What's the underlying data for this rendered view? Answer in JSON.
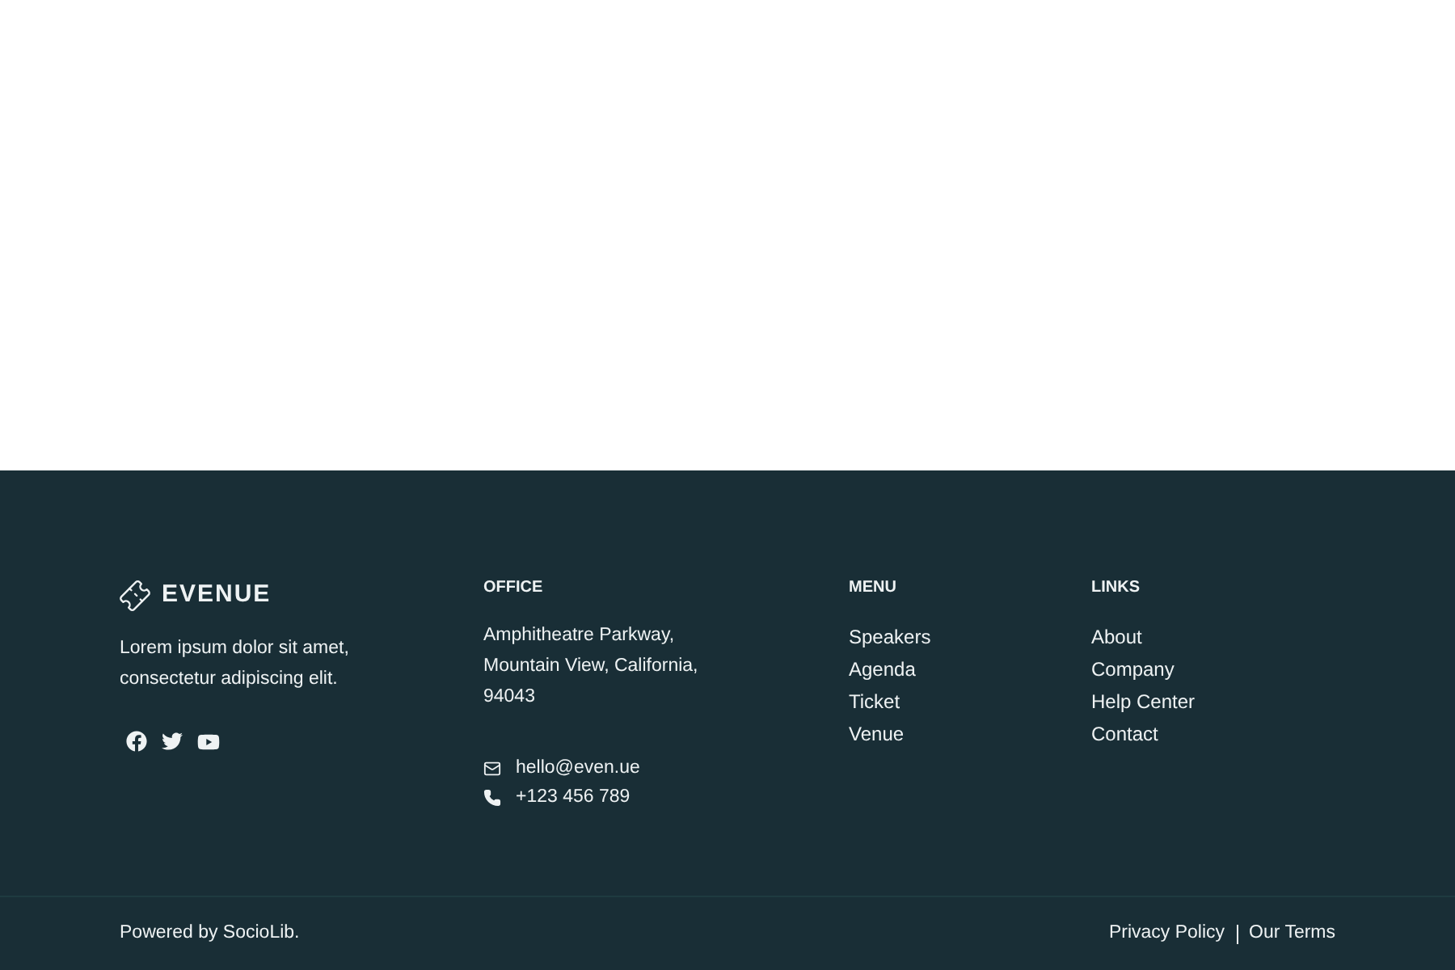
{
  "brand": {
    "name": "EVENUE",
    "tagline": "Lorem ipsum dolor sit amet, consectetur adipiscing elit."
  },
  "office": {
    "heading": "OFFICE",
    "address": "Amphitheatre Parkway, Mountain View, California, 94043",
    "email": "hello@even.ue",
    "phone": "+123 456 789"
  },
  "menu": {
    "heading": "MENU",
    "items": [
      "Speakers",
      "Agenda",
      "Ticket",
      "Venue"
    ]
  },
  "links": {
    "heading": "LINKS",
    "items": [
      "About",
      "Company",
      "Help Center",
      "Contact"
    ]
  },
  "bottom_bar": {
    "powered_by": "Powered by SocioLib.",
    "links": [
      "Privacy Policy",
      "Our Terms"
    ]
  }
}
